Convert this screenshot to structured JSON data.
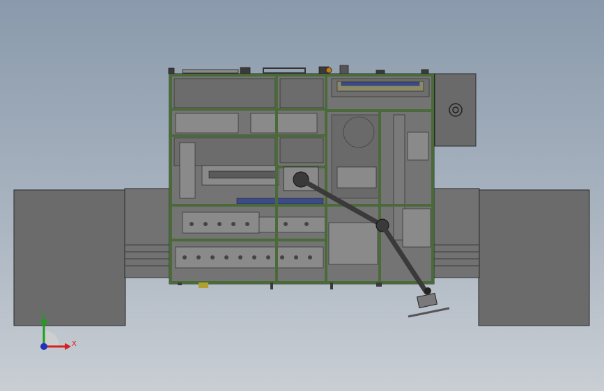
{
  "viewport": {
    "background_top": "#8a9aac",
    "background_bottom": "#c9ced4"
  },
  "model": {
    "frame_color": "#4a6a3a",
    "panel_color": "#707070",
    "block_color": "#6a6a6a",
    "arm_color": "#3a3a3a"
  },
  "triad": {
    "x_label": "X",
    "y_label": "Y",
    "x_color": "#d42020",
    "y_color": "#1aa01a",
    "z_color": "#2030c0"
  }
}
